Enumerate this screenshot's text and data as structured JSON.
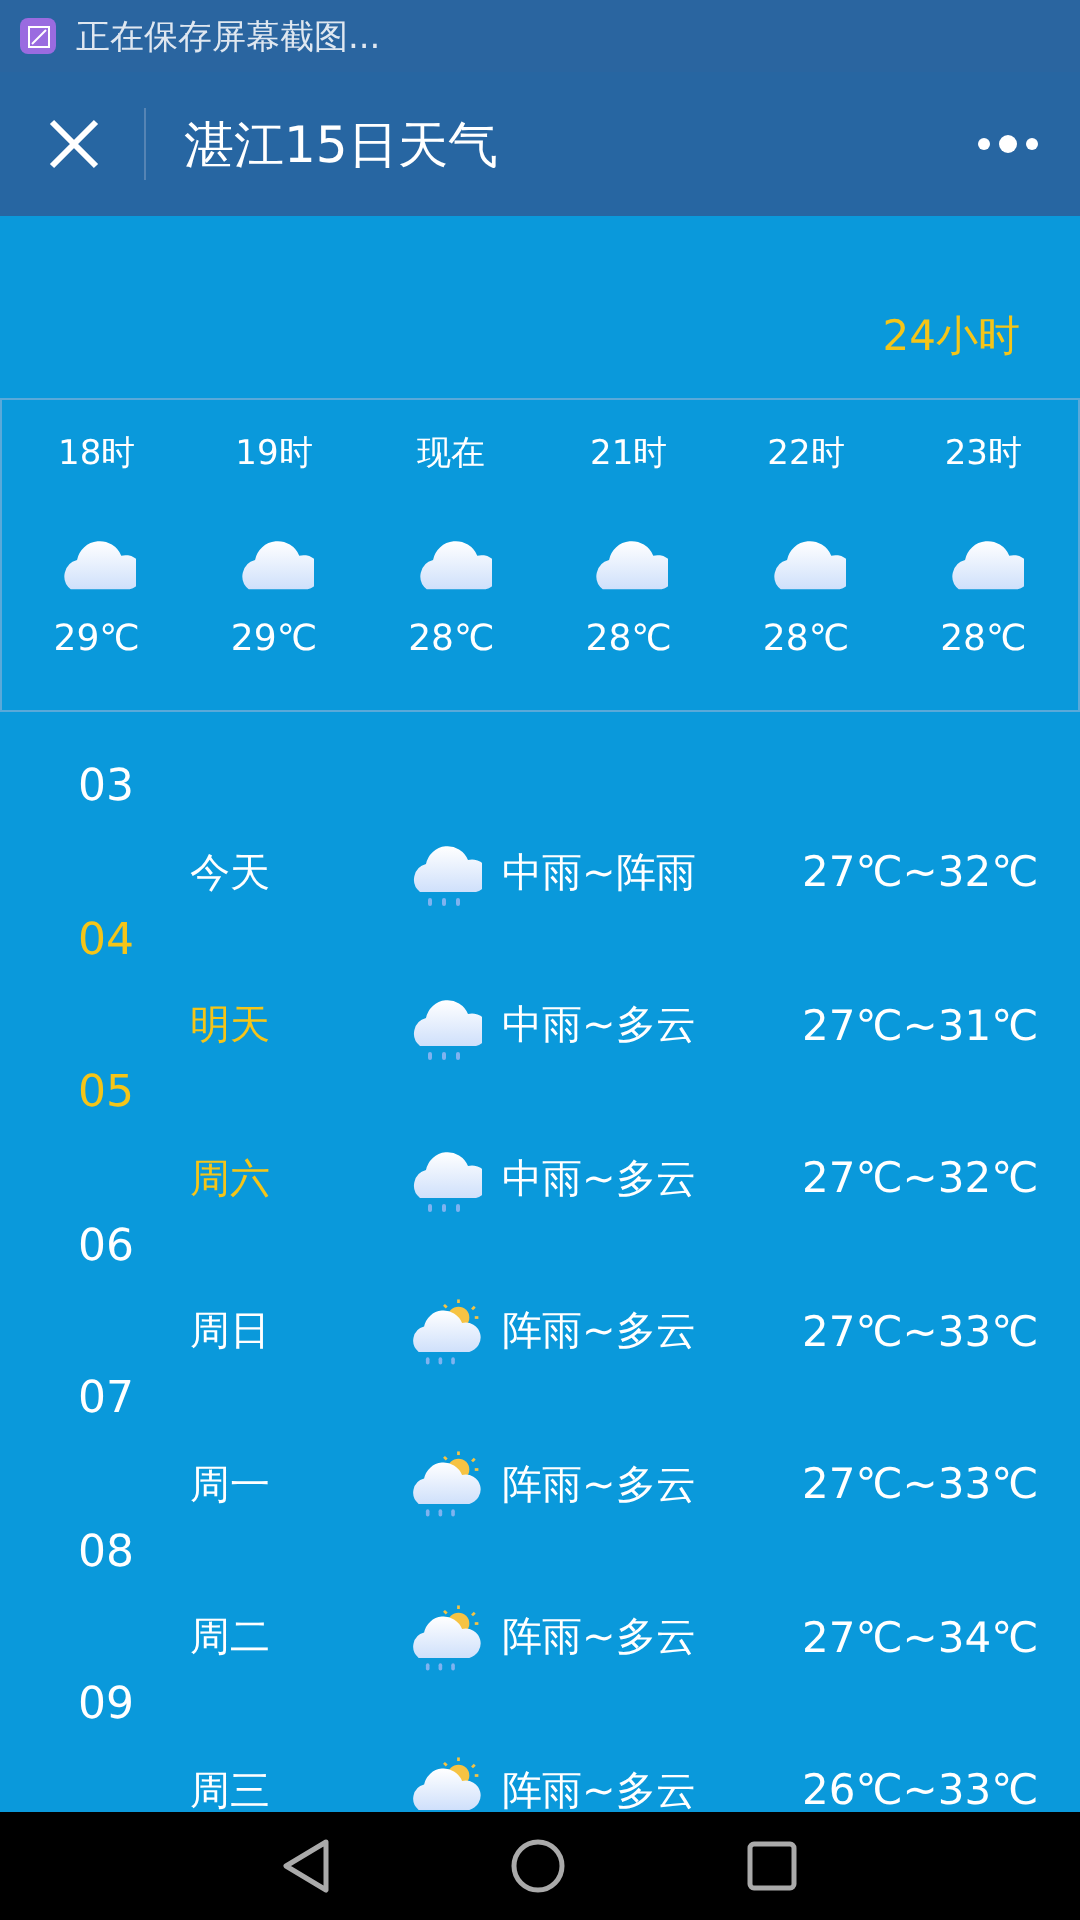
{
  "status_bar": {
    "notification": "正在保存屏幕截图..."
  },
  "header": {
    "title": "湛江15日天气"
  },
  "hourly": {
    "label": "24小时",
    "hours": [
      {
        "time": "18时",
        "kind": "cloud",
        "temp": "29℃"
      },
      {
        "time": "19时",
        "kind": "cloud",
        "temp": "29℃"
      },
      {
        "time": "现在",
        "kind": "cloud",
        "temp": "28℃"
      },
      {
        "time": "21时",
        "kind": "cloud",
        "temp": "28℃"
      },
      {
        "time": "22时",
        "kind": "cloud",
        "temp": "28℃"
      },
      {
        "time": "23时",
        "kind": "cloud",
        "temp": "28℃"
      }
    ]
  },
  "days": [
    {
      "date": "03",
      "day": "今天",
      "highlighted": false,
      "kind": "rain",
      "weather": "中雨~阵雨",
      "temp": "27℃~32℃"
    },
    {
      "date": "04",
      "day": "明天",
      "highlighted": true,
      "kind": "rain",
      "weather": "中雨~多云",
      "temp": "27℃~31℃"
    },
    {
      "date": "05",
      "day": "周六",
      "highlighted": true,
      "kind": "rain",
      "weather": "中雨~多云",
      "temp": "27℃~32℃"
    },
    {
      "date": "06",
      "day": "周日",
      "highlighted": false,
      "kind": "sun_rain",
      "weather": "阵雨~多云",
      "temp": "27℃~33℃"
    },
    {
      "date": "07",
      "day": "周一",
      "highlighted": false,
      "kind": "sun_rain",
      "weather": "阵雨~多云",
      "temp": "27℃~33℃"
    },
    {
      "date": "08",
      "day": "周二",
      "highlighted": false,
      "kind": "sun_rain",
      "weather": "阵雨~多云",
      "temp": "27℃~34℃"
    },
    {
      "date": "09",
      "day": "周三",
      "highlighted": false,
      "kind": "sun_rain",
      "weather": "阵雨~多云",
      "temp": "26℃~33℃"
    }
  ]
}
